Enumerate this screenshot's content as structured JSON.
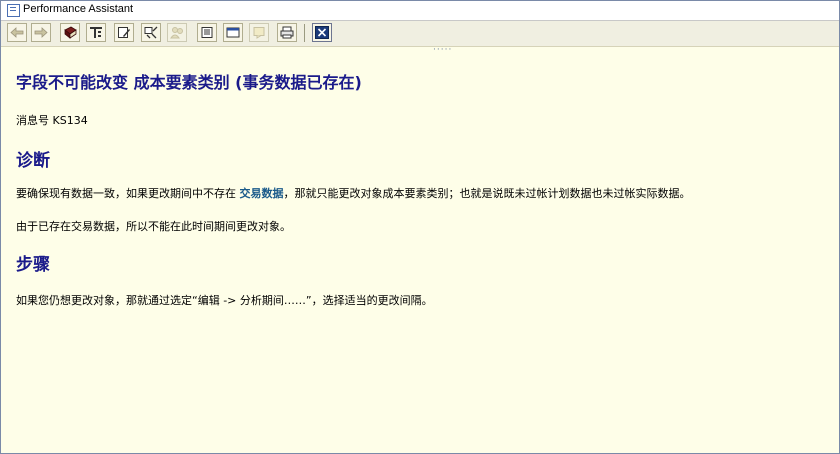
{
  "window": {
    "title": "Performance Assistant"
  },
  "toolbar": {
    "buttons": [
      {
        "icon": "arrow-left-icon"
      },
      {
        "icon": "arrow-right-icon"
      },
      {
        "icon": "book-icon"
      },
      {
        "icon": "glossary-icon"
      },
      {
        "icon": "edit-icon"
      },
      {
        "icon": "technical-info-icon"
      },
      {
        "icon": "user-icon"
      },
      {
        "icon": "page-icon"
      },
      {
        "icon": "window-icon"
      },
      {
        "icon": "notes-icon"
      },
      {
        "icon": "print-icon"
      },
      {
        "icon": "close-icon"
      }
    ]
  },
  "content": {
    "title": "字段不可能改变  成本要素类别  (事务数据已存在)",
    "message_number": "消息号  KS134",
    "diagnosis_heading": "诊断",
    "diagnosis_p1_before": "要确保现有数据一致，如果更改期间中不存在 ",
    "diagnosis_p1_link": "交易数据",
    "diagnosis_p1_after": "，那就只能更改对象成本要素类别；也就是说既未过帐计划数据也未过帐实际数据。",
    "diagnosis_p2": "由于已存在交易数据，所以不能在此时间期间更改对象。",
    "procedure_heading": "步骤",
    "procedure_p1": "如果您仍想更改对象，那就通过选定“编辑 -> 分析期间……”，选择适当的更改间隔。"
  }
}
